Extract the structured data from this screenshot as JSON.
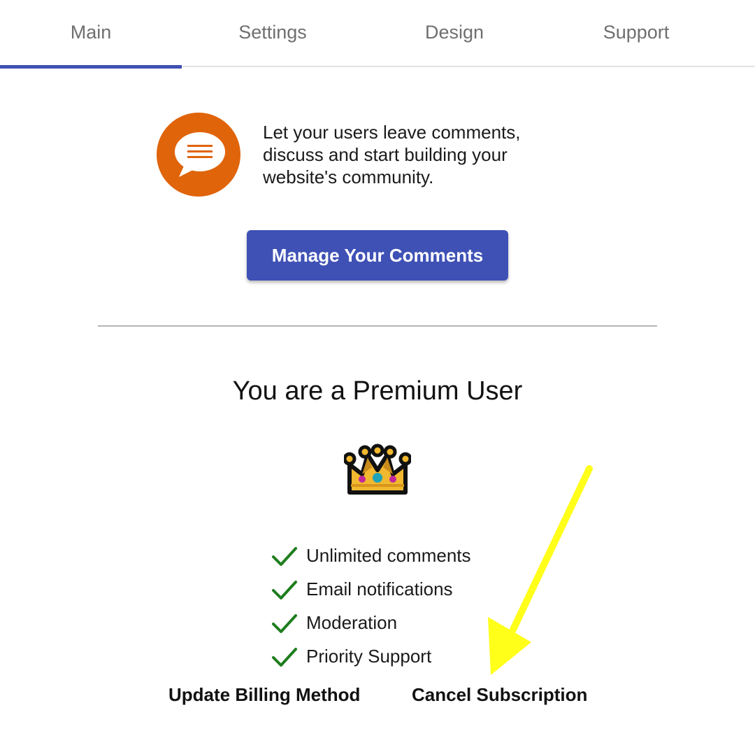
{
  "tabs": [
    {
      "label": "Main",
      "active": true
    },
    {
      "label": "Settings",
      "active": false
    },
    {
      "label": "Design",
      "active": false
    },
    {
      "label": "Support",
      "active": false
    }
  ],
  "intro": {
    "icon": "chat-bubble-icon",
    "lines": [
      "Let your users leave comments,",
      "discuss and start building your",
      "website's community."
    ]
  },
  "manage_button": {
    "label": "Manage Your Comments"
  },
  "premium": {
    "title": "You are a Premium User",
    "icon": "crown-icon",
    "features": [
      "Unlimited comments",
      "Email notifications",
      "Moderation",
      "Priority Support"
    ]
  },
  "links": {
    "update_billing": "Update Billing Method",
    "cancel_subscription": "Cancel Subscription"
  },
  "colors": {
    "accent": "#3f51b5",
    "icon_bg": "#e0640a",
    "check": "#1e7d1e",
    "annotation_arrow": "#ffff1a"
  }
}
